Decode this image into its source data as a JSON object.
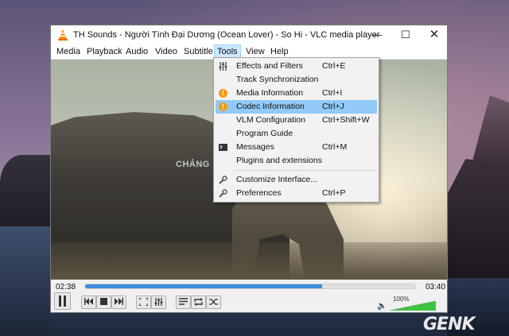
{
  "window": {
    "title": "TH Sounds - Người Tình Đại Dương (Ocean Lover) - So Hi - VLC media player",
    "min_icon": "minimize-icon",
    "max_icon": "maximize-icon",
    "close_icon": "close-icon"
  },
  "menubar": {
    "items": [
      {
        "label": "Media"
      },
      {
        "label": "Playback"
      },
      {
        "label": "Audio"
      },
      {
        "label": "Video"
      },
      {
        "label": "Subtitle"
      },
      {
        "label": "Tools",
        "active": true
      },
      {
        "label": "View"
      },
      {
        "label": "Help"
      }
    ]
  },
  "tools_menu": {
    "items": [
      {
        "label": "Effects and Filters",
        "shortcut": "Ctrl+E",
        "icon": "equalizer-icon"
      },
      {
        "label": "Track Synchronization",
        "shortcut": "",
        "icon": ""
      },
      {
        "label": "Media Information",
        "shortcut": "Ctrl+I",
        "icon": "info-icon"
      },
      {
        "label": "Codec Information",
        "shortcut": "Ctrl+J",
        "icon": "info-icon",
        "highlighted": true
      },
      {
        "label": "VLM Configuration",
        "shortcut": "Ctrl+Shift+W",
        "icon": ""
      },
      {
        "label": "Program Guide",
        "shortcut": "",
        "icon": ""
      },
      {
        "label": "Messages",
        "shortcut": "Ctrl+M",
        "icon": "terminal-icon"
      },
      {
        "label": "Plugins and extensions",
        "shortcut": "",
        "icon": ""
      },
      {
        "label": "Customize Interface...",
        "shortcut": "",
        "icon": "wrench-icon"
      },
      {
        "label": "Preferences",
        "shortcut": "Ctrl+P",
        "icon": "wrench-icon"
      }
    ]
  },
  "video": {
    "subtitle_text": "CHẢNG"
  },
  "controls": {
    "elapsed": "02:38",
    "total": "03:40",
    "progress_fraction": 0.718,
    "volume_label": "100%",
    "volume_fraction": 1.0
  },
  "watermark": {
    "text": "GENK"
  },
  "colors": {
    "accent": "#3f8ee0",
    "menu_highlight": "#91c9f7",
    "volume_green": "#3ec43e",
    "info_orange": "#f39b1c"
  }
}
